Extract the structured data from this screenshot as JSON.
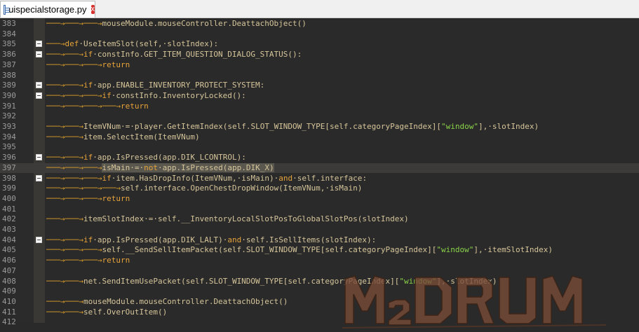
{
  "tab": {
    "title": "uispecialstorage.py",
    "close_label": "x",
    "icon": "python-file-icon"
  },
  "editor": {
    "lines": [
      {
        "num": "383",
        "fold": false,
        "ws": "───→───→───→",
        "code": "mouseModule.mouseController.DeattachObject()"
      },
      {
        "num": "384",
        "fold": false,
        "ws": "",
        "code": ""
      },
      {
        "num": "385",
        "fold": true,
        "ws": "───→",
        "code": "def·UseItemSlot(self,·slotIndex):"
      },
      {
        "num": "386",
        "fold": true,
        "ws": "───→───→",
        "code": "if·constInfo.GET_ITEM_QUESTION_DIALOG_STATUS():"
      },
      {
        "num": "387",
        "fold": false,
        "ws": "───→───→───→",
        "code": "return"
      },
      {
        "num": "388",
        "fold": false,
        "ws": "",
        "code": ""
      },
      {
        "num": "389",
        "fold": true,
        "ws": "───→───→",
        "code": "if·app.ENABLE_INVENTORY_PROTECT_SYSTEM:"
      },
      {
        "num": "390",
        "fold": true,
        "ws": "───→───→───→",
        "code": "if·constInfo.InventoryLocked():"
      },
      {
        "num": "391",
        "fold": false,
        "ws": "───→───→───→───→",
        "code": "return"
      },
      {
        "num": "392",
        "fold": false,
        "ws": "",
        "code": ""
      },
      {
        "num": "393",
        "fold": false,
        "ws": "───→───→",
        "code": "ItemVNum·=·player.GetItemIndex(self.SLOT_WINDOW_TYPE[self.categoryPageIndex][\"window\"],·slotIndex)"
      },
      {
        "num": "394",
        "fold": false,
        "ws": "───→───→",
        "code": "item.SelectItem(ItemVNum)"
      },
      {
        "num": "395",
        "fold": false,
        "ws": "",
        "code": ""
      },
      {
        "num": "396",
        "fold": true,
        "ws": "───→───→",
        "code": "if·app.IsPressed(app.DIK_LCONTROL):"
      },
      {
        "num": "397",
        "fold": false,
        "ws": "───→───→───→",
        "code": "isMain·=·not·app.IsPressed(app.DIK_X)"
      },
      {
        "num": "398",
        "fold": true,
        "ws": "───→───→───→",
        "code": "if·item.HasDropInfo(ItemVNum,·isMain)·and·self.interface:"
      },
      {
        "num": "399",
        "fold": false,
        "ws": "───→───→───→───→",
        "code": "self.interface.OpenChestDropWindow(ItemVNum,·isMain)"
      },
      {
        "num": "400",
        "fold": false,
        "ws": "───→───→───→",
        "code": "return"
      },
      {
        "num": "401",
        "fold": false,
        "ws": "",
        "code": ""
      },
      {
        "num": "402",
        "fold": false,
        "ws": "───→───→",
        "code": "itemSlotIndex·=·self.__InventoryLocalSlotPosToGlobalSlotPos(slotIndex)"
      },
      {
        "num": "403",
        "fold": false,
        "ws": "",
        "code": ""
      },
      {
        "num": "404",
        "fold": true,
        "ws": "───→───→",
        "code": "if·app.IsPressed(app.DIK_LALT)·and·self.IsSellItems(slotIndex):"
      },
      {
        "num": "405",
        "fold": false,
        "ws": "───→───→───→",
        "code": "self.__SendSellItemPacket(self.SLOT_WINDOW_TYPE[self.categoryPageIndex][\"window\"],·itemSlotIndex)"
      },
      {
        "num": "406",
        "fold": false,
        "ws": "───→───→───→",
        "code": "return"
      },
      {
        "num": "407",
        "fold": false,
        "ws": "",
        "code": ""
      },
      {
        "num": "408",
        "fold": false,
        "ws": "───→───→",
        "code": "net.SendItemUsePacket(self.SLOT_WINDOW_TYPE[self.categoryPageIndex][\"window\"],·slotIndex)"
      },
      {
        "num": "409",
        "fold": false,
        "ws": "",
        "code": ""
      },
      {
        "num": "410",
        "fold": false,
        "ws": "───→───→",
        "code": "mouseModule.mouseController.DeattachObject()"
      },
      {
        "num": "411",
        "fold": false,
        "ws": "───→───→",
        "code": "self.OverOutItem()"
      },
      {
        "num": "412",
        "fold": false,
        "ws": "",
        "code": ""
      }
    ],
    "current_line_index": 14
  },
  "watermark": {
    "text": "M2DRUM",
    "kind": "logo"
  },
  "colors": {
    "background": "#2a2a2a",
    "text": "#d6c59a",
    "whitespace_marker": "#d99c2b",
    "keyword": "#e7a33a",
    "string": "#8ad24a",
    "line_number": "#9a9a9a",
    "watermark": "#8a5a44"
  }
}
